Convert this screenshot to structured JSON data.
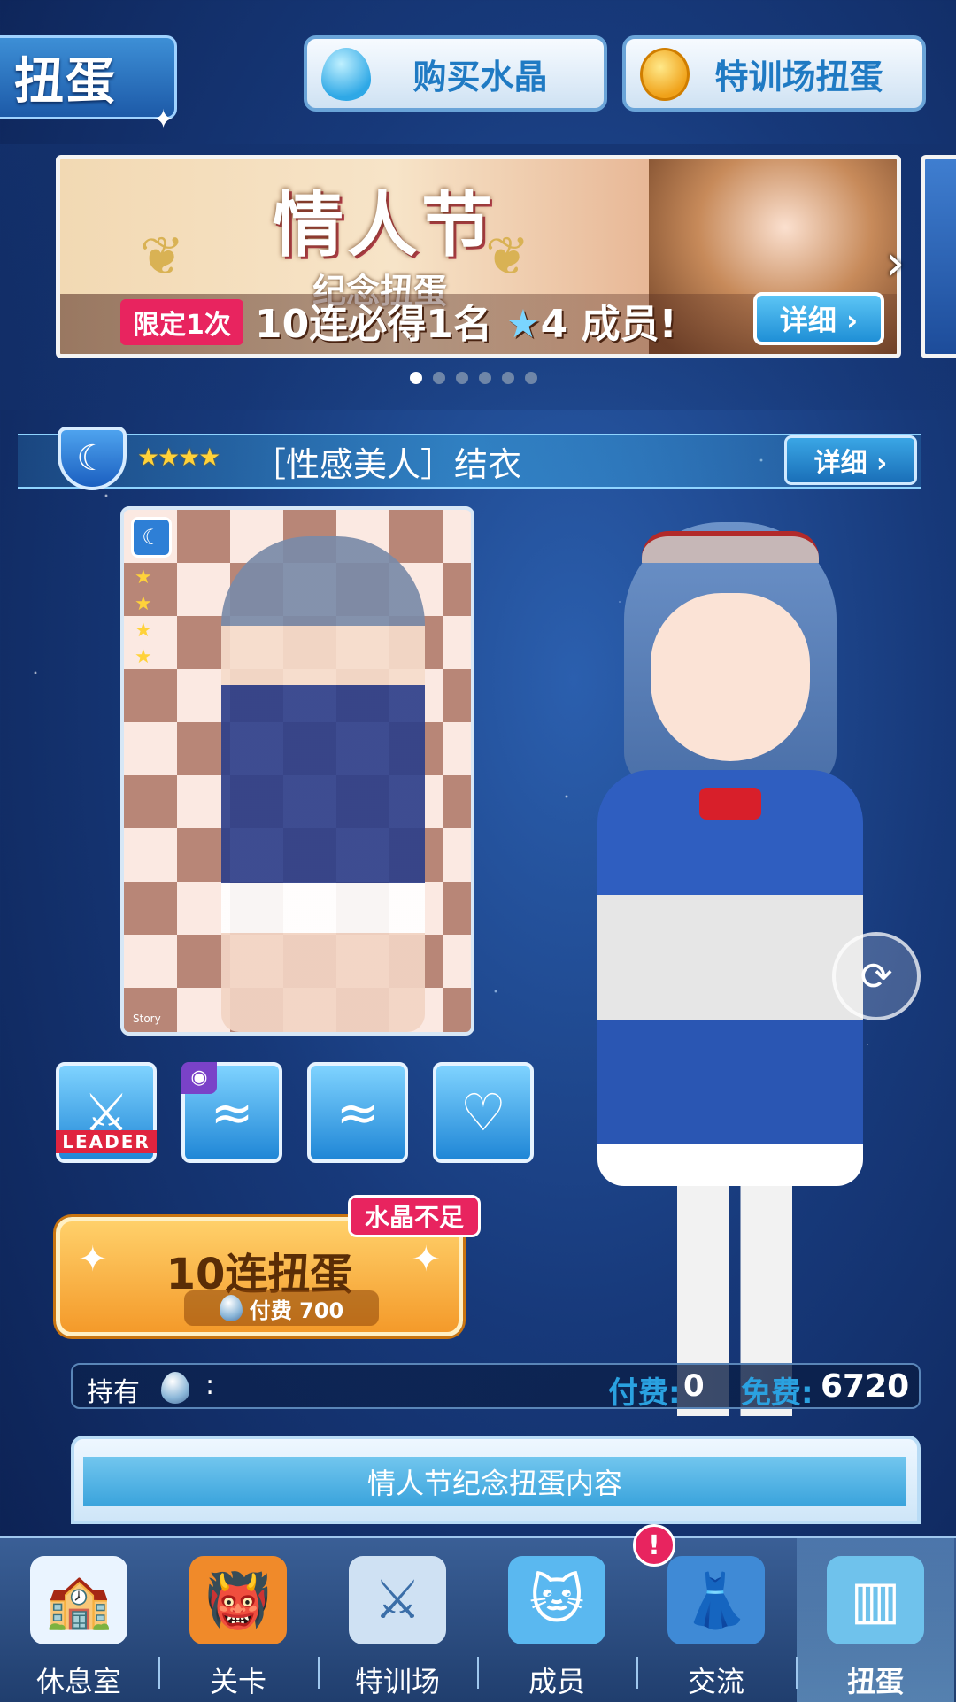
{
  "header": {
    "title": "扭蛋",
    "buy_crystal": "购买水晶",
    "training_gacha": "特训场扭蛋"
  },
  "banner": {
    "title": "情人节",
    "subtitle": "纪念扭蛋",
    "limited_tag": "限定1次",
    "promo_prefix": "10连必得1名",
    "promo_star": "4",
    "promo_suffix": "成员!",
    "detail": "详细 ›",
    "page_count": 6,
    "active_page": 1
  },
  "card": {
    "rarity": "★★★★",
    "name": "［性感美人］结衣",
    "detail": "详细 ›",
    "story_label": "Story",
    "type_icon": "moon-icon",
    "card_rarity_stars": "★\n★\n★\n★"
  },
  "skills": {
    "leader_tag": "LEADER",
    "items": [
      "sword-icon",
      "wave-eye-icon",
      "wave-icon",
      "heart-hands-icon"
    ]
  },
  "gacha": {
    "main": "10连扭蛋",
    "cost_label": "付费 700",
    "insufficient": "水晶不足"
  },
  "balance": {
    "own_label": "持有",
    "colon": ":",
    "paid_label": "付费:",
    "paid_value": "0",
    "free_label": "免费:",
    "free_value": "6720"
  },
  "contents": {
    "label": "情人节纪念扭蛋内容"
  },
  "nav": {
    "items": [
      {
        "label": "休息室",
        "icon": "school-icon"
      },
      {
        "label": "关卡",
        "icon": "monster-icon"
      },
      {
        "label": "特训场",
        "icon": "crossed-swords-icon"
      },
      {
        "label": "成员",
        "icon": "cat-mascot-icon"
      },
      {
        "label": "交流",
        "icon": "dress-icon"
      },
      {
        "label": "扭蛋",
        "icon": "curtain-icon"
      }
    ],
    "badge": "!",
    "active": "扭蛋"
  },
  "colors": {
    "accent_pink": "#e8245f",
    "accent_blue": "#1f7ac3",
    "gold": "#f49a2a"
  }
}
